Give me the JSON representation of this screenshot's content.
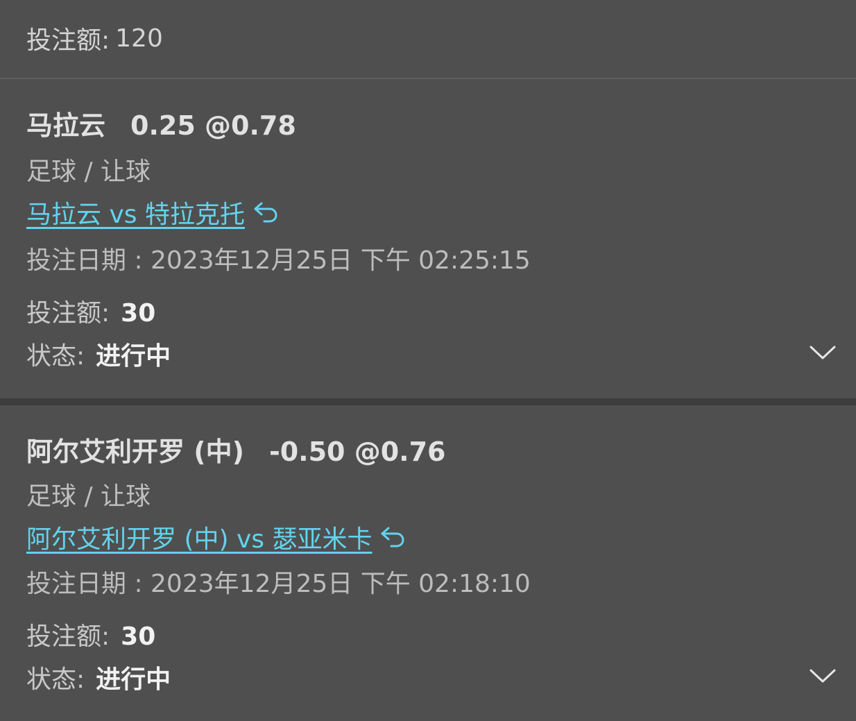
{
  "summary": {
    "label": "投注额:",
    "value": "120"
  },
  "bets": [
    {
      "selection": "马拉云",
      "odds": "0.25 @0.78",
      "sport_market": "足球 / 让球",
      "match": "马拉云 vs 特拉克托",
      "date_label": "投注日期 : ",
      "date": "2023年12月25日 下午 02:25:15",
      "amount_label": "投注额:",
      "amount": "30",
      "status_label": "状态:",
      "status": "进行中"
    },
    {
      "selection": "阿尔艾利开罗 (中)",
      "odds": "-0.50 @0.76",
      "sport_market": "足球 / 让球",
      "match": "阿尔艾利开罗 (中) vs 瑟亚米卡",
      "date_label": "投注日期 : ",
      "date": "2023年12月25日 下午 02:18:10",
      "amount_label": "投注额:",
      "amount": "30",
      "status_label": "状态:",
      "status": "进行中"
    }
  ],
  "colors": {
    "background": "#4f4f4f",
    "link": "#62d3ee",
    "divider": "#3d3d3d"
  },
  "icons": {
    "match_link": "return-arrow-icon",
    "expand": "chevron-down-icon"
  }
}
